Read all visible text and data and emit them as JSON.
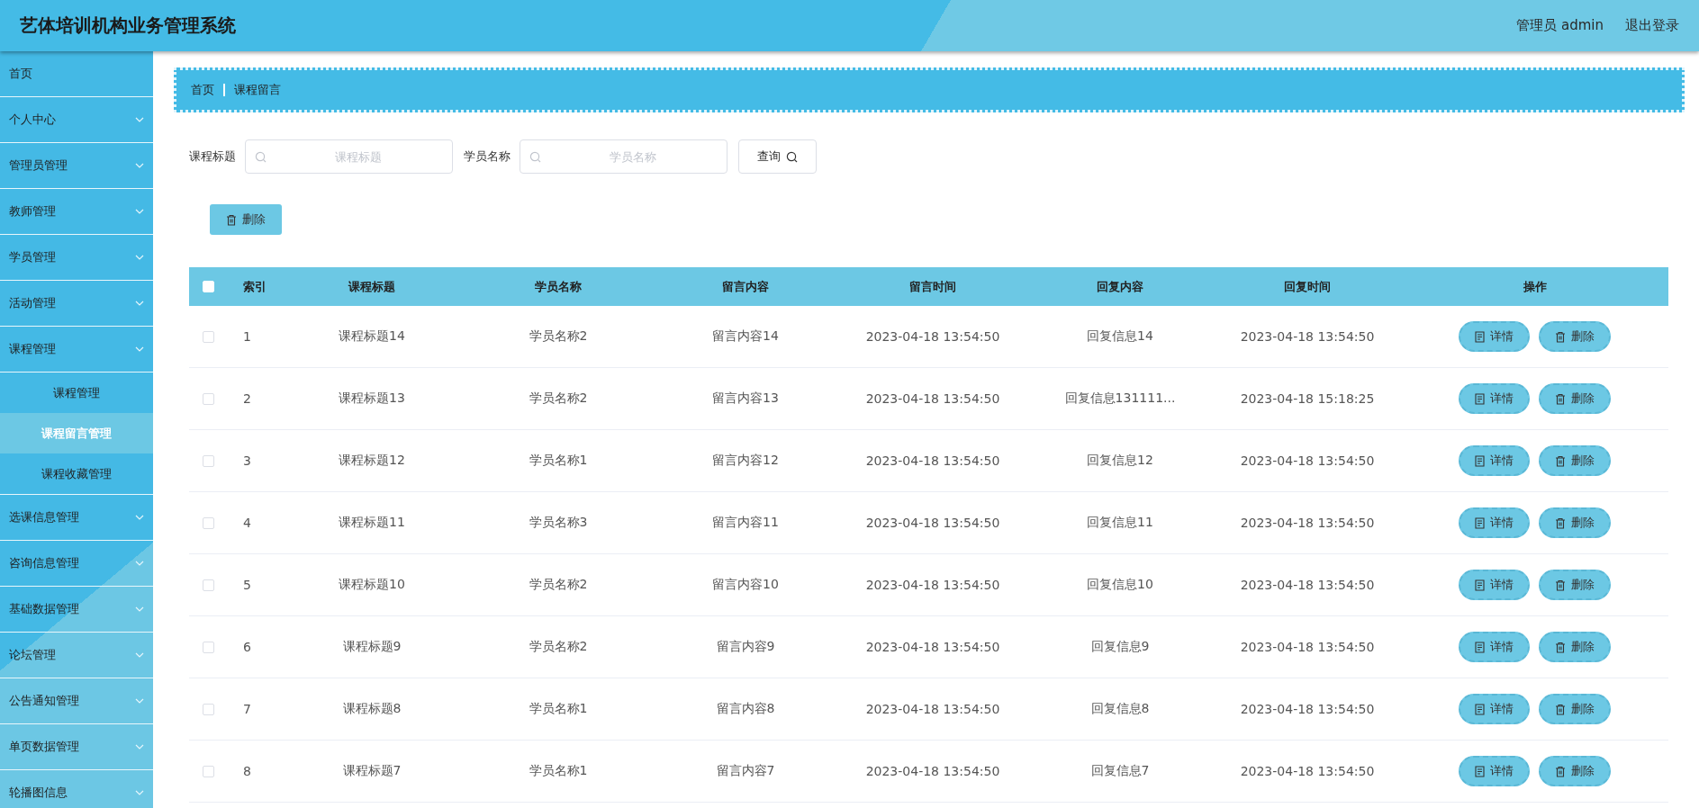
{
  "header": {
    "title": "艺体培训机构业务管理系统",
    "user": "管理员 admin",
    "logout": "退出登录"
  },
  "sidebar": {
    "items": [
      {
        "label": "首页",
        "kind": "link"
      },
      {
        "label": "个人中心",
        "kind": "menu"
      },
      {
        "label": "管理员管理",
        "kind": "menu"
      },
      {
        "label": "教师管理",
        "kind": "menu"
      },
      {
        "label": "学员管理",
        "kind": "menu"
      },
      {
        "label": "活动管理",
        "kind": "menu"
      },
      {
        "label": "课程管理",
        "kind": "menu",
        "children": [
          {
            "label": "课程管理",
            "selected": false
          },
          {
            "label": "课程留言管理",
            "selected": true
          },
          {
            "label": "课程收藏管理",
            "selected": false
          }
        ]
      },
      {
        "label": "选课信息管理",
        "kind": "menu"
      },
      {
        "label": "咨询信息管理",
        "kind": "menu"
      },
      {
        "label": "基础数据管理",
        "kind": "menu"
      },
      {
        "label": "论坛管理",
        "kind": "menu"
      },
      {
        "label": "公告通知管理",
        "kind": "menu"
      },
      {
        "label": "单页数据管理",
        "kind": "menu"
      },
      {
        "label": "轮播图信息",
        "kind": "menu"
      }
    ]
  },
  "breadcrumb": [
    "首页",
    "课程留言"
  ],
  "search": {
    "fields": [
      {
        "label": "课程标题",
        "placeholder": "课程标题"
      },
      {
        "label": "学员名称",
        "placeholder": "学员名称"
      }
    ],
    "button": "查询"
  },
  "toolbar": {
    "delete": "删除"
  },
  "table": {
    "select_all_checked": false,
    "columns": [
      "索引",
      "课程标题",
      "学员名称",
      "留言内容",
      "留言时间",
      "回复内容",
      "回复时间",
      "操作"
    ],
    "rows": [
      {
        "checked": false,
        "cells": [
          "1",
          "课程标题14",
          "学员名称2",
          "留言内容14",
          "2023-04-18 13:54:50",
          "回复信息14",
          "2023-04-18 13:54:50"
        ],
        "actions": [
          "详情",
          "删除"
        ]
      },
      {
        "checked": false,
        "cells": [
          "2",
          "课程标题13",
          "学员名称2",
          "留言内容13",
          "2023-04-18 13:54:50",
          "回复信息131111...",
          "2023-04-18 15:18:25"
        ],
        "actions": [
          "详情",
          "删除"
        ]
      },
      {
        "checked": false,
        "cells": [
          "3",
          "课程标题12",
          "学员名称1",
          "留言内容12",
          "2023-04-18 13:54:50",
          "回复信息12",
          "2023-04-18 13:54:50"
        ],
        "actions": [
          "详情",
          "删除"
        ]
      },
      {
        "checked": false,
        "cells": [
          "4",
          "课程标题11",
          "学员名称3",
          "留言内容11",
          "2023-04-18 13:54:50",
          "回复信息11",
          "2023-04-18 13:54:50"
        ],
        "actions": [
          "详情",
          "删除"
        ]
      },
      {
        "checked": false,
        "cells": [
          "5",
          "课程标题10",
          "学员名称2",
          "留言内容10",
          "2023-04-18 13:54:50",
          "回复信息10",
          "2023-04-18 13:54:50"
        ],
        "actions": [
          "详情",
          "删除"
        ]
      },
      {
        "checked": false,
        "cells": [
          "6",
          "课程标题9",
          "学员名称2",
          "留言内容9",
          "2023-04-18 13:54:50",
          "回复信息9",
          "2023-04-18 13:54:50"
        ],
        "actions": [
          "详情",
          "删除"
        ]
      },
      {
        "checked": false,
        "cells": [
          "7",
          "课程标题8",
          "学员名称1",
          "留言内容8",
          "2023-04-18 13:54:50",
          "回复信息8",
          "2023-04-18 13:54:50"
        ],
        "actions": [
          "详情",
          "删除"
        ]
      },
      {
        "checked": false,
        "cells": [
          "8",
          "课程标题7",
          "学员名称1",
          "留言内容7",
          "2023-04-18 13:54:50",
          "回复信息7",
          "2023-04-18 13:54:50"
        ],
        "actions": [
          "详情",
          "删除"
        ]
      }
    ]
  }
}
